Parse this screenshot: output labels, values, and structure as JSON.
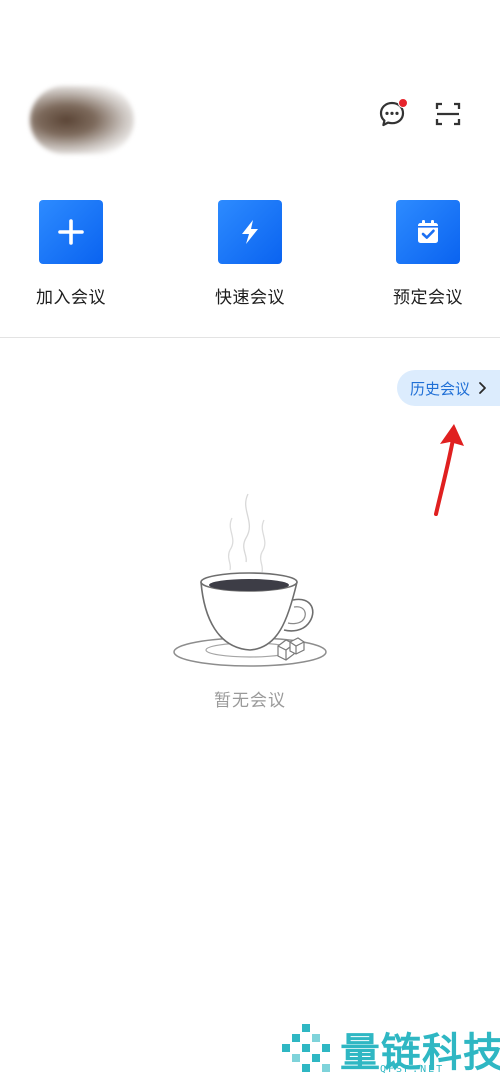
{
  "header": {
    "avatar_icon": "user-avatar-blurred",
    "chat_icon": "chat-bubble-icon",
    "chat_has_notification": true,
    "scan_icon": "scan-icon"
  },
  "actions": [
    {
      "label": "加入会议",
      "icon": "plus-icon"
    },
    {
      "label": "快速会议",
      "icon": "lightning-icon"
    },
    {
      "label": "预定会议",
      "icon": "calendar-check-icon"
    }
  ],
  "history": {
    "label": "历史会议",
    "icon": "chevron-right-icon"
  },
  "empty_state": {
    "text": "暂无会议",
    "illustration": "coffee-cup-icon"
  },
  "watermark": {
    "name": "量链科技",
    "domain": "QFSP.NET"
  },
  "colors": {
    "accent": "#1a73f5",
    "history_bg": "#dcecfd",
    "history_text": "#1f6fd6",
    "notification": "#e6242c",
    "annotation_arrow": "#e02020",
    "watermark": "#2fb7c3"
  }
}
